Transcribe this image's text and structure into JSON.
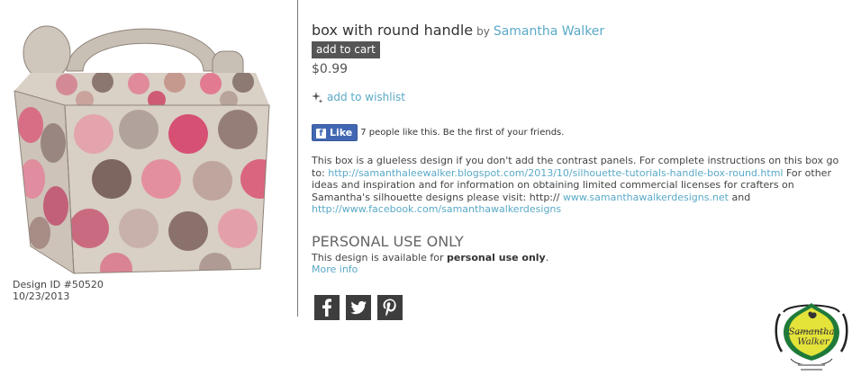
{
  "product": {
    "title": "box with round handle",
    "by_label": "by",
    "author": "Samantha Walker",
    "add_to_cart_label": "add to cart",
    "price": "$0.99",
    "wishlist_label": "add to wishlist",
    "image_icon": "polka-dot-handle-box-image"
  },
  "meta": {
    "design_id": "Design ID #50520",
    "date": "10/23/2013"
  },
  "facebook": {
    "like_label": "Like",
    "like_text": "7 people like this. Be the first of your friends."
  },
  "description": {
    "part1": "This box is a glueless design if you don't add the contrast panels. For complete instructions on this box go to: ",
    "link1": "http://samanthaleewalker.blogspot.com/2013/10/silhouette-tutorials-handle-box-round.html",
    "part2": " For other ideas and inspiration and for information on obtaining limited commercial licenses for crafters on Samantha's silhouette designs please visit: http:// ",
    "link2": "www.samanthawalkerdesigns.net",
    "part3": " and ",
    "link3": "http://www.facebook.com/samanthawalkerdesigns"
  },
  "license": {
    "heading": "PERSONAL USE ONLY",
    "text_prefix": "This design is available for ",
    "text_bold": "personal use only",
    "text_suffix": ".",
    "more_info": "More info"
  },
  "social": {
    "icons": [
      "facebook-icon",
      "twitter-icon",
      "pinterest-icon"
    ]
  },
  "logo": {
    "name": "Samantha Walker",
    "line1": "Samantha",
    "line2": "Walker"
  },
  "colors": {
    "link": "#5aa9c7",
    "button": "#555555",
    "facebook": "#4267b2",
    "social": "#3d3d3d"
  }
}
